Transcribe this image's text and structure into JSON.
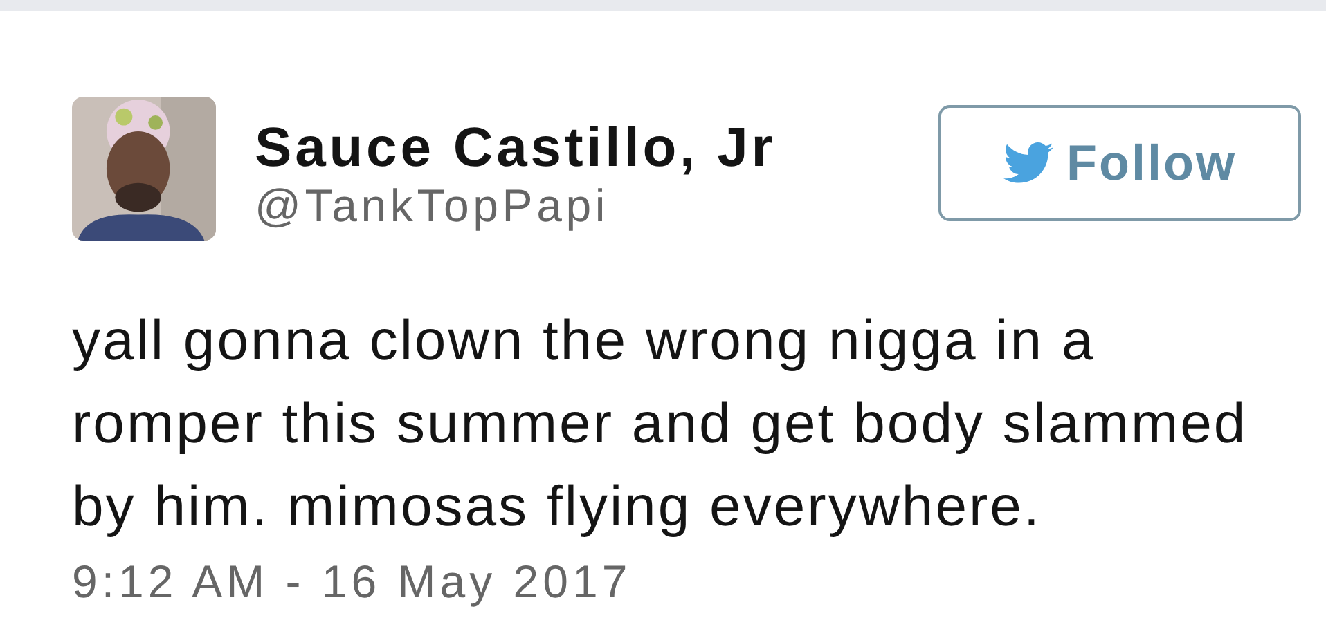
{
  "author": {
    "name": "Sauce Castillo, Jr",
    "handle": "@TankTopPapi"
  },
  "follow_button": {
    "label": "Follow"
  },
  "tweet": {
    "text": "yall gonna clown the wrong nigga in a romper this summer and get body slammed by him. mimosas flying everywhere.",
    "timestamp": "9:12 AM - 16 May 2017"
  }
}
